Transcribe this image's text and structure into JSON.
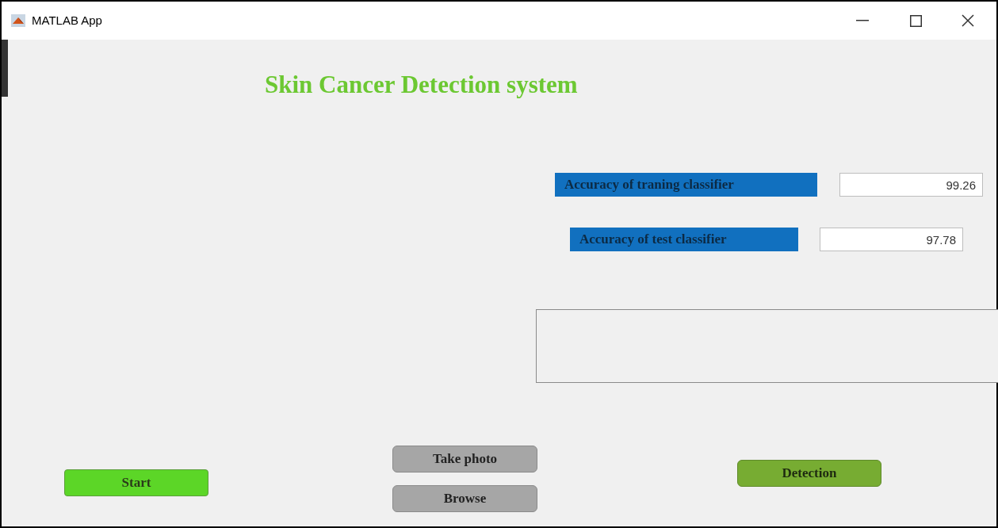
{
  "window": {
    "title": "MATLAB App"
  },
  "heading": "Skin Cancer Detection system",
  "fields": [
    {
      "label": "Accuracy of traning classifier",
      "value": "99.26"
    },
    {
      "label": "Accuracy of test classifier",
      "value": "97.78"
    }
  ],
  "buttons": [
    {
      "label": "Start",
      "color": "#5cd627"
    },
    {
      "label": "Take photo",
      "color": "#a6a6a6"
    },
    {
      "label": "Browse",
      "color": "#a6a6a6"
    },
    {
      "label": "Detection",
      "color": "#77ac32"
    }
  ]
}
